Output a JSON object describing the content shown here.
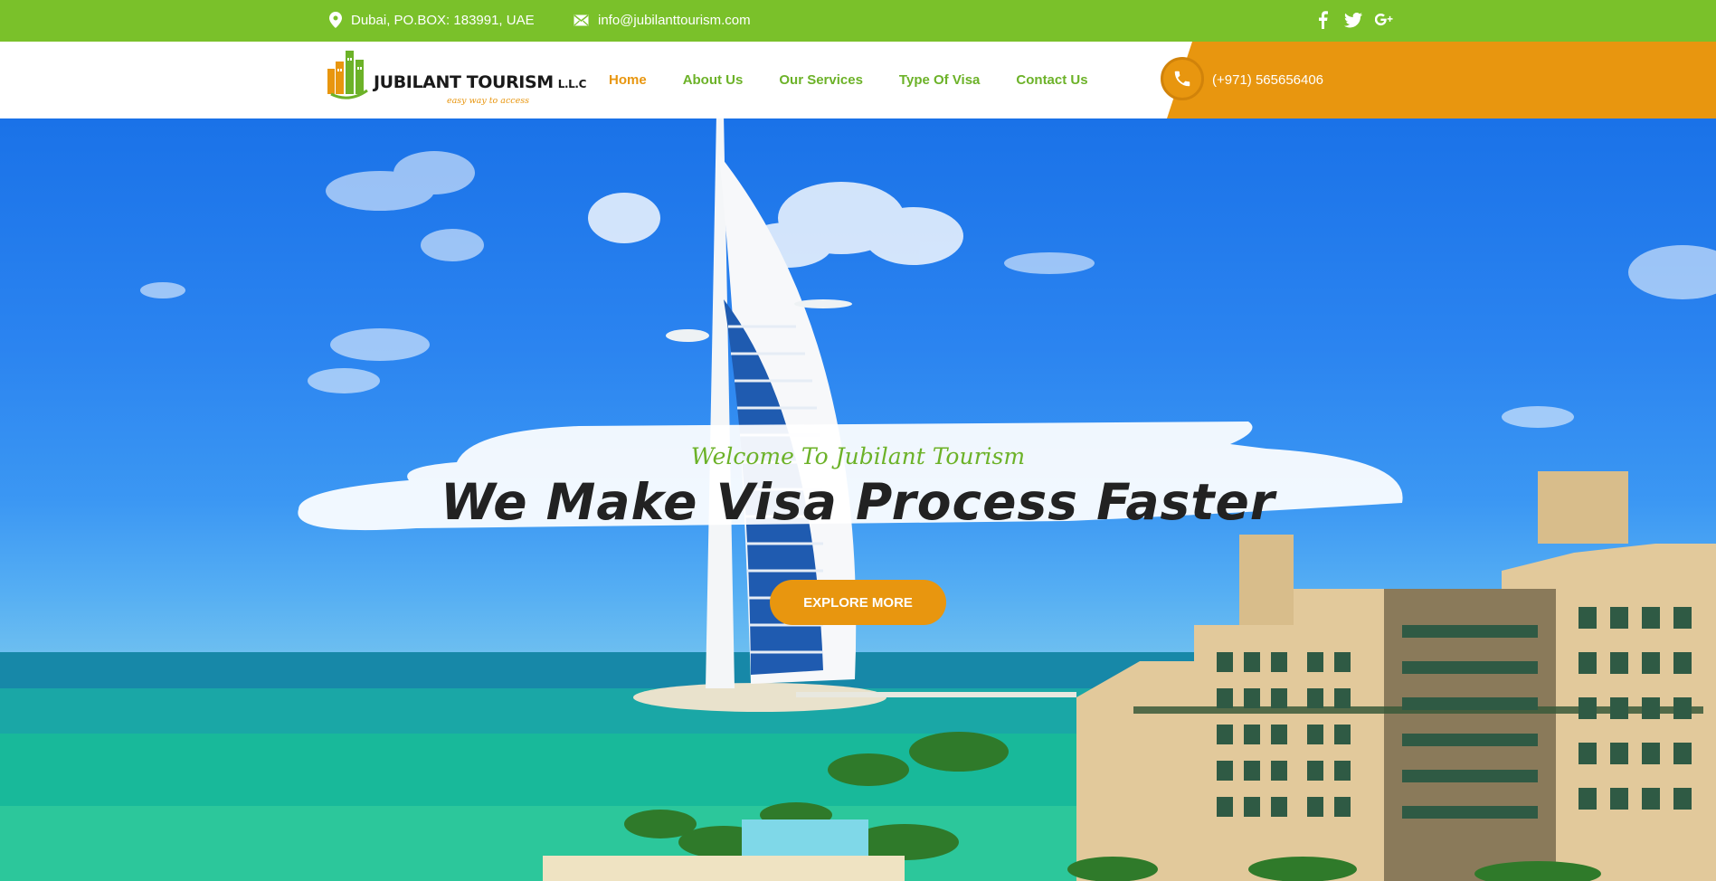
{
  "topbar": {
    "address": "Dubai, PO.BOX: 183991, UAE",
    "email": "info@jubilanttourism.com",
    "social_icons": [
      "facebook-icon",
      "twitter-icon",
      "google-plus-icon"
    ]
  },
  "header": {
    "logo": {
      "name": "JUBILANT TOURISM",
      "suffix": "L.L.C",
      "tagline": "easy way to access"
    },
    "nav": {
      "items": [
        {
          "label": "Home",
          "active": true
        },
        {
          "label": "About Us",
          "active": false
        },
        {
          "label": "Our Services",
          "active": false
        },
        {
          "label": "Type Of Visa",
          "active": false
        },
        {
          "label": "Contact Us",
          "active": false
        }
      ]
    },
    "phone": "(+971) 565656406"
  },
  "hero": {
    "welcome": "Welcome To Jubilant Tourism",
    "headline": "We Make Visa Process Faster",
    "button_label": "EXPLORE MORE"
  },
  "colors": {
    "green": "#7ac12a",
    "nav_green": "#6cb228",
    "orange": "#e8960f",
    "sky": "#2b84f0",
    "sea": "#17b9a3"
  }
}
